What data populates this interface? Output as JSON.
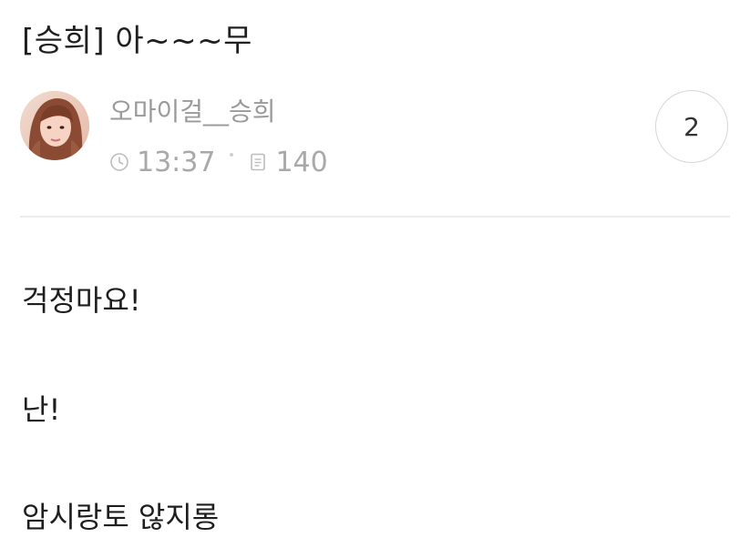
{
  "post": {
    "title": "[승희] 아~~~무",
    "author": "오마이걸__승희",
    "time": "13:37",
    "views": "140",
    "comment_count": "2"
  },
  "icons": {
    "time": "clock-icon",
    "views": "document-icon"
  },
  "body": {
    "lines": [
      "걱정마요!",
      "난!",
      "암시랑토 않지롱"
    ]
  },
  "colors": {
    "title": "#1f1f1f",
    "meta": "#a9a9a9",
    "divider": "#ececec",
    "comment_border": "#d6d6d6"
  }
}
